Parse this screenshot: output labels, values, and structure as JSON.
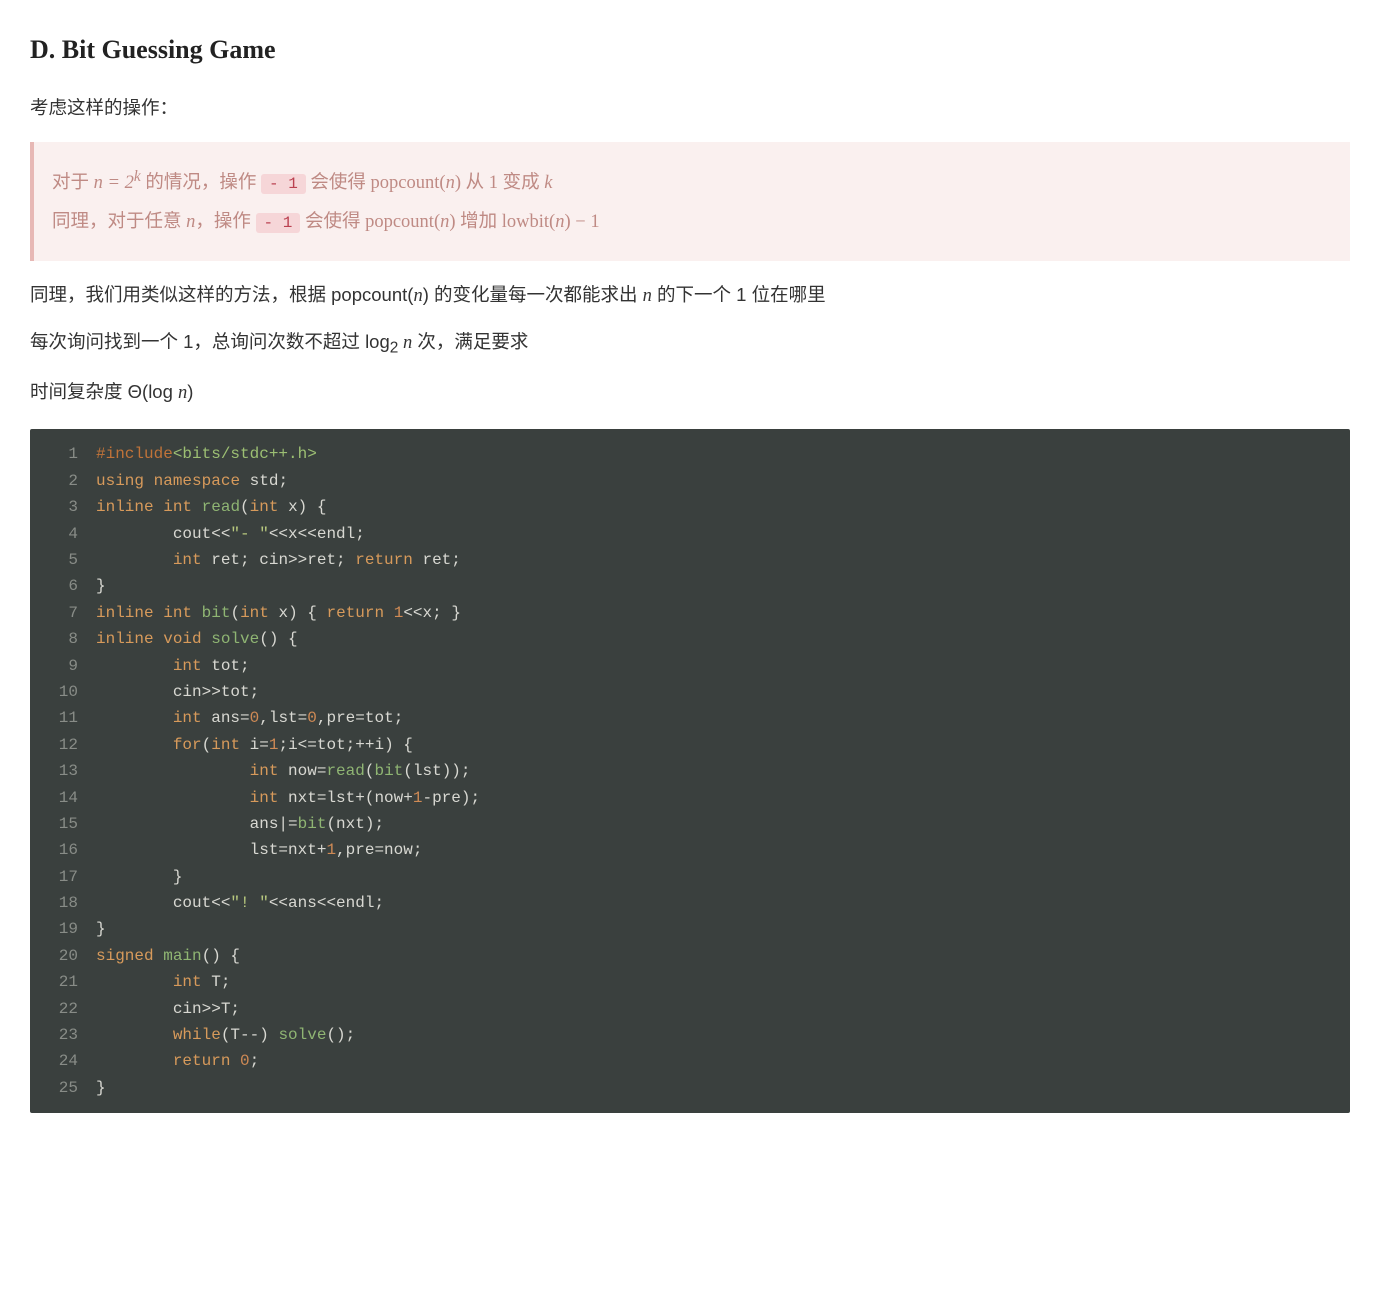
{
  "title": "D. Bit Guessing Game",
  "intro": "考虑这样的操作：",
  "bq": {
    "l1_a": "对于 ",
    "l1_n_eq": "n = 2",
    "l1_k": "k",
    "l1_b": " 的情况，操作 ",
    "l1_code": "- 1",
    "l1_c": " 会使得 popcount(",
    "l1_n1": "n",
    "l1_d": ") 从 1 变成 ",
    "l1_k2": "k",
    "l2_a": "同理，对于任意 ",
    "l2_n": "n",
    "l2_b": "，操作 ",
    "l2_code": "- 1",
    "l2_c": " 会使得 popcount(",
    "l2_n2": "n",
    "l2_d": ") 增加 lowbit(",
    "l2_n3": "n",
    "l2_e": ") − 1"
  },
  "p1_a": "同理，我们用类似这样的方法，根据 popcount(",
  "p1_n1": "n",
  "p1_b": ") 的变化量每一次都能求出 ",
  "p1_n2": "n",
  "p1_c": " 的下一个 1 位在哪里",
  "p2_a": "每次询问找到一个 1，总询问次数不超过 log",
  "p2_sub": "2",
  "p2_n": " n",
  "p2_b": " 次，满足要求",
  "p3_a": "时间复杂度 Θ(log ",
  "p3_n": "n",
  "p3_b": ")",
  "code": {
    "lines": [
      {
        "n": "1",
        "tokens": [
          [
            "pre",
            "#include"
          ],
          [
            "inc",
            "<bits/stdc++.h>"
          ]
        ]
      },
      {
        "n": "2",
        "tokens": [
          [
            "kw",
            "using"
          ],
          [
            "op",
            " "
          ],
          [
            "kw",
            "namespace"
          ],
          [
            "op",
            " std;"
          ]
        ]
      },
      {
        "n": "3",
        "tokens": [
          [
            "kw",
            "inline"
          ],
          [
            "op",
            " "
          ],
          [
            "kw",
            "int"
          ],
          [
            "op",
            " "
          ],
          [
            "fn",
            "read"
          ],
          [
            "op",
            "("
          ],
          [
            "kw",
            "int"
          ],
          [
            "op",
            " x) {"
          ]
        ]
      },
      {
        "n": "4",
        "tokens": [
          [
            "op",
            "        cout<<"
          ],
          [
            "str",
            "\"- \""
          ],
          [
            "op",
            "<<x<<endl;"
          ]
        ]
      },
      {
        "n": "5",
        "tokens": [
          [
            "op",
            "        "
          ],
          [
            "kw",
            "int"
          ],
          [
            "op",
            " ret; cin>>ret; "
          ],
          [
            "kw",
            "return"
          ],
          [
            "op",
            " ret;"
          ]
        ]
      },
      {
        "n": "6",
        "tokens": [
          [
            "op",
            "}"
          ]
        ]
      },
      {
        "n": "7",
        "tokens": [
          [
            "kw",
            "inline"
          ],
          [
            "op",
            " "
          ],
          [
            "kw",
            "int"
          ],
          [
            "op",
            " "
          ],
          [
            "fn",
            "bit"
          ],
          [
            "op",
            "("
          ],
          [
            "kw",
            "int"
          ],
          [
            "op",
            " x) { "
          ],
          [
            "kw",
            "return"
          ],
          [
            "op",
            " "
          ],
          [
            "num",
            "1"
          ],
          [
            "op",
            "<<x; }"
          ]
        ]
      },
      {
        "n": "8",
        "tokens": [
          [
            "kw",
            "inline"
          ],
          [
            "op",
            " "
          ],
          [
            "kw",
            "void"
          ],
          [
            "op",
            " "
          ],
          [
            "fn",
            "solve"
          ],
          [
            "op",
            "() {"
          ]
        ]
      },
      {
        "n": "9",
        "tokens": [
          [
            "op",
            "        "
          ],
          [
            "kw",
            "int"
          ],
          [
            "op",
            " tot;"
          ]
        ]
      },
      {
        "n": "10",
        "tokens": [
          [
            "op",
            "        cin>>tot;"
          ]
        ]
      },
      {
        "n": "11",
        "tokens": [
          [
            "op",
            "        "
          ],
          [
            "kw",
            "int"
          ],
          [
            "op",
            " ans="
          ],
          [
            "num",
            "0"
          ],
          [
            "op",
            ",lst="
          ],
          [
            "num",
            "0"
          ],
          [
            "op",
            ",pre=tot;"
          ]
        ]
      },
      {
        "n": "12",
        "tokens": [
          [
            "op",
            "        "
          ],
          [
            "kw",
            "for"
          ],
          [
            "op",
            "("
          ],
          [
            "kw",
            "int"
          ],
          [
            "op",
            " i="
          ],
          [
            "num",
            "1"
          ],
          [
            "op",
            ";i<=tot;++i) {"
          ]
        ]
      },
      {
        "n": "13",
        "tokens": [
          [
            "op",
            "                "
          ],
          [
            "kw",
            "int"
          ],
          [
            "op",
            " now="
          ],
          [
            "fn",
            "read"
          ],
          [
            "op",
            "("
          ],
          [
            "fn",
            "bit"
          ],
          [
            "op",
            "(lst));"
          ]
        ]
      },
      {
        "n": "14",
        "tokens": [
          [
            "op",
            "                "
          ],
          [
            "kw",
            "int"
          ],
          [
            "op",
            " nxt=lst+(now+"
          ],
          [
            "num",
            "1"
          ],
          [
            "op",
            "-pre);"
          ]
        ]
      },
      {
        "n": "15",
        "tokens": [
          [
            "op",
            "                ans|="
          ],
          [
            "fn",
            "bit"
          ],
          [
            "op",
            "(nxt);"
          ]
        ]
      },
      {
        "n": "16",
        "tokens": [
          [
            "op",
            "                lst=nxt+"
          ],
          [
            "num",
            "1"
          ],
          [
            "op",
            ",pre=now;"
          ]
        ]
      },
      {
        "n": "17",
        "tokens": [
          [
            "op",
            "        }"
          ]
        ]
      },
      {
        "n": "18",
        "tokens": [
          [
            "op",
            "        cout<<"
          ],
          [
            "str",
            "\"! \""
          ],
          [
            "op",
            "<<ans<<endl;"
          ]
        ]
      },
      {
        "n": "19",
        "tokens": [
          [
            "op",
            "}"
          ]
        ]
      },
      {
        "n": "20",
        "tokens": [
          [
            "kw",
            "signed"
          ],
          [
            "op",
            " "
          ],
          [
            "fn",
            "main"
          ],
          [
            "op",
            "() {"
          ]
        ]
      },
      {
        "n": "21",
        "tokens": [
          [
            "op",
            "        "
          ],
          [
            "kw",
            "int"
          ],
          [
            "op",
            " T;"
          ]
        ]
      },
      {
        "n": "22",
        "tokens": [
          [
            "op",
            "        cin>>T;"
          ]
        ]
      },
      {
        "n": "23",
        "tokens": [
          [
            "op",
            "        "
          ],
          [
            "kw",
            "while"
          ],
          [
            "op",
            "(T--) "
          ],
          [
            "fn",
            "solve"
          ],
          [
            "op",
            "();"
          ]
        ]
      },
      {
        "n": "24",
        "tokens": [
          [
            "op",
            "        "
          ],
          [
            "kw",
            "return"
          ],
          [
            "op",
            " "
          ],
          [
            "num",
            "0"
          ],
          [
            "op",
            ";"
          ]
        ]
      },
      {
        "n": "25",
        "tokens": [
          [
            "op",
            "}"
          ]
        ]
      }
    ]
  }
}
